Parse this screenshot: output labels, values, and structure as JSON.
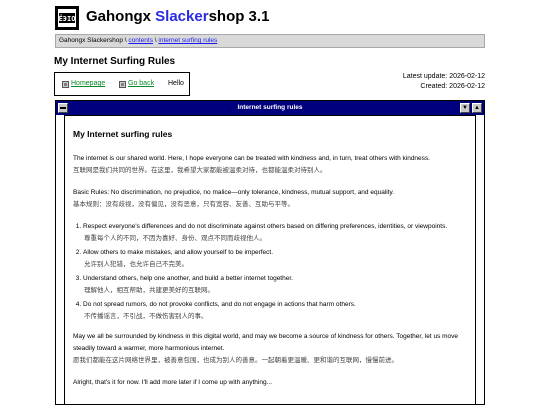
{
  "header": {
    "logo_text": "ЁЭIO",
    "title_part1": "Gahongx ",
    "title_accent": "Slacker",
    "title_part2": "shop 3.1",
    "accent_color": "#2a2ae0"
  },
  "breadcrumb": {
    "root": "Gahongx Slackershop",
    "sep1": " \\ ",
    "contents": "contents",
    "sep2": " \\ ",
    "current": "internet surfing rules"
  },
  "page_title": "My Internet Surfing Rules",
  "links": {
    "homepage": "Homepage",
    "go_back": "Go back",
    "hello": "Hello",
    "link_color": "#0a8a2a"
  },
  "updates": {
    "last_update": "Latest update: 2026-02-12",
    "created": "Created: 2026-02-12"
  },
  "window": {
    "title": "Internet surfing rules",
    "titlebar_color": "#00007e",
    "down_icon": "▼",
    "up_icon": "▲"
  },
  "content": {
    "heading": "My Internet surfing rules",
    "intro_en": "The internet is our shared world. Here, I hope everyone can be treated with kindness and, in turn, treat others with kindness.",
    "intro_zh": "互联网是我们共同的世界。在这里，我希望大家都能被温柔对待，也都能温柔对待别人。",
    "basic_en": "Basic Rules: No discrimination, no prejudice, no malice—only tolerance, kindness, mutual support, and equality.",
    "basic_zh": "基本规则：没有歧视，没有偏见，没有恶意，只有宽容、友善、互助与平等。",
    "rules": [
      {
        "en": "Respect everyone's differences and do not discriminate against others based on differing preferences, identities, or viewpoints.",
        "zh": "尊重每个人的不同，不因为喜好、身份、观点不同而歧视他人。"
      },
      {
        "en": "Allow others to make mistakes, and allow yourself to be imperfect.",
        "zh": "允许别人犯错，也允许自己不完美。"
      },
      {
        "en": "Understand others, help one another, and build a better internet together.",
        "zh": "理解他人，相互帮助，共建更美好的互联网。"
      },
      {
        "en": "Do not spread rumors, do not provoke conflicts, and do not engage in actions that harm others.",
        "zh": "不传播谣言，不引战，不做伤害别人的事。"
      }
    ],
    "closing_en": "May we all be surrounded by kindness in this digital world, and may we become a source of kindness for others. Together, let us move steadily toward a warmer, more harmonious internet.",
    "closing_zh": "愿我们都能在这片网络世界里，被善意包围，也成为别人的善意。一起朝着更温暖、更和谐的互联网，慢慢前进。",
    "signoff": "Alright, that's it for now. I'll add more later if I come up with anything..."
  }
}
